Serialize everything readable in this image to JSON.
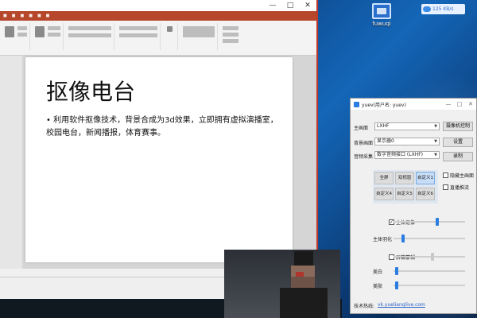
{
  "desktop": {
    "icon_label": "fuwuqi",
    "net_speed": "125 KB/s"
  },
  "ppt": {
    "slide_title": "抠像电台",
    "slide_body": "• 利用软件抠像技术，背景合成为3d效果，立即拥有虚拟演播室，校园电台，新闻播报，体育赛事。"
  },
  "dialog": {
    "title": "yuev(用户名: yuev)",
    "rows": {
      "main_screen_label": "主画面",
      "main_screen_value": "LXHF",
      "bg_label": "背景画面",
      "bg_value": "显示器0",
      "audio_label": "音频采集",
      "audio_value": "数字音频接口 (LXHF)"
    },
    "buttons": {
      "camera_control": "摄像机控制",
      "settings": "设置",
      "record": "录制"
    },
    "layout_buttons": [
      "全屏",
      "双视窗",
      "自定义1",
      "自定义4",
      "自定义5",
      "自定义6"
    ],
    "checkboxes": {
      "hide_main": "隐藏主画面",
      "live_stream": "直播推流"
    },
    "sliders": {
      "main_keying": "主体抠像",
      "main_feather": "主体羽化",
      "screen_blur": "屏幕蒙糊",
      "whitening": "美白",
      "smoothing": "美肤"
    },
    "slider_levels": {
      "main_keying": 0.62,
      "main_feather": 0.12,
      "screen_blur": 0.55,
      "whitening": 0.02,
      "smoothing": 0.02
    },
    "hotline_label": "技术热线:",
    "hotline_link": "vk.yuelianglive.com"
  }
}
